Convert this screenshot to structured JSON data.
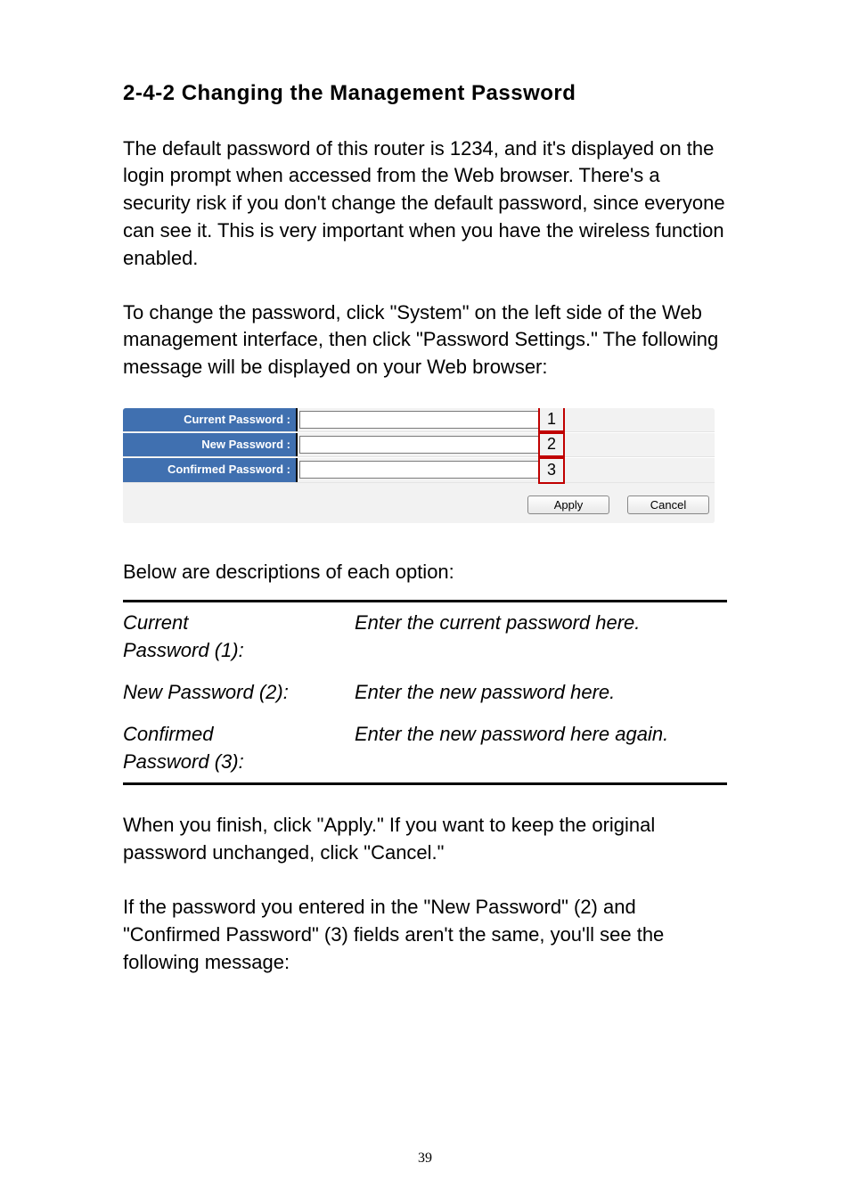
{
  "section_title": "2-4-2 Changing the Management Password",
  "intro_para_1": "The default password of this router is 1234, and it's displayed on the login prompt when accessed from the Web browser. There's a security risk if you don't change the default password, since everyone can see it. This is very important when you have the wireless function enabled.",
  "intro_para_2": "To change the password, click \"System\" on the left side of the Web management interface, then click \"Password Settings.\" The following message will be displayed on your Web browser:",
  "form": {
    "rows": [
      {
        "label": "Current Password :",
        "callout": "1"
      },
      {
        "label": "New Password :",
        "callout": "2"
      },
      {
        "label": "Confirmed Password :",
        "callout": "3"
      }
    ],
    "apply_label": "Apply",
    "cancel_label": "Cancel"
  },
  "desc_intro": "Below are descriptions of each option:",
  "desc_rows": [
    {
      "left_l1": "Current",
      "left_l2": "Password (1):",
      "right": "Enter the current password here."
    },
    {
      "left_l1": "New Password (2):",
      "left_l2": "",
      "right": "Enter the new password here."
    },
    {
      "left_l1": "Confirmed",
      "left_l2": "Password (3):",
      "right": "Enter the new password here again."
    }
  ],
  "outro_para_1": "When you finish, click \"Apply.\" If you want to keep the original password unchanged, click \"Cancel.\"",
  "outro_para_2": "If the password you entered in the \"New Password\" (2) and \"Confirmed Password\" (3) fields aren't the same, you'll see the following message:",
  "page_number": "39"
}
